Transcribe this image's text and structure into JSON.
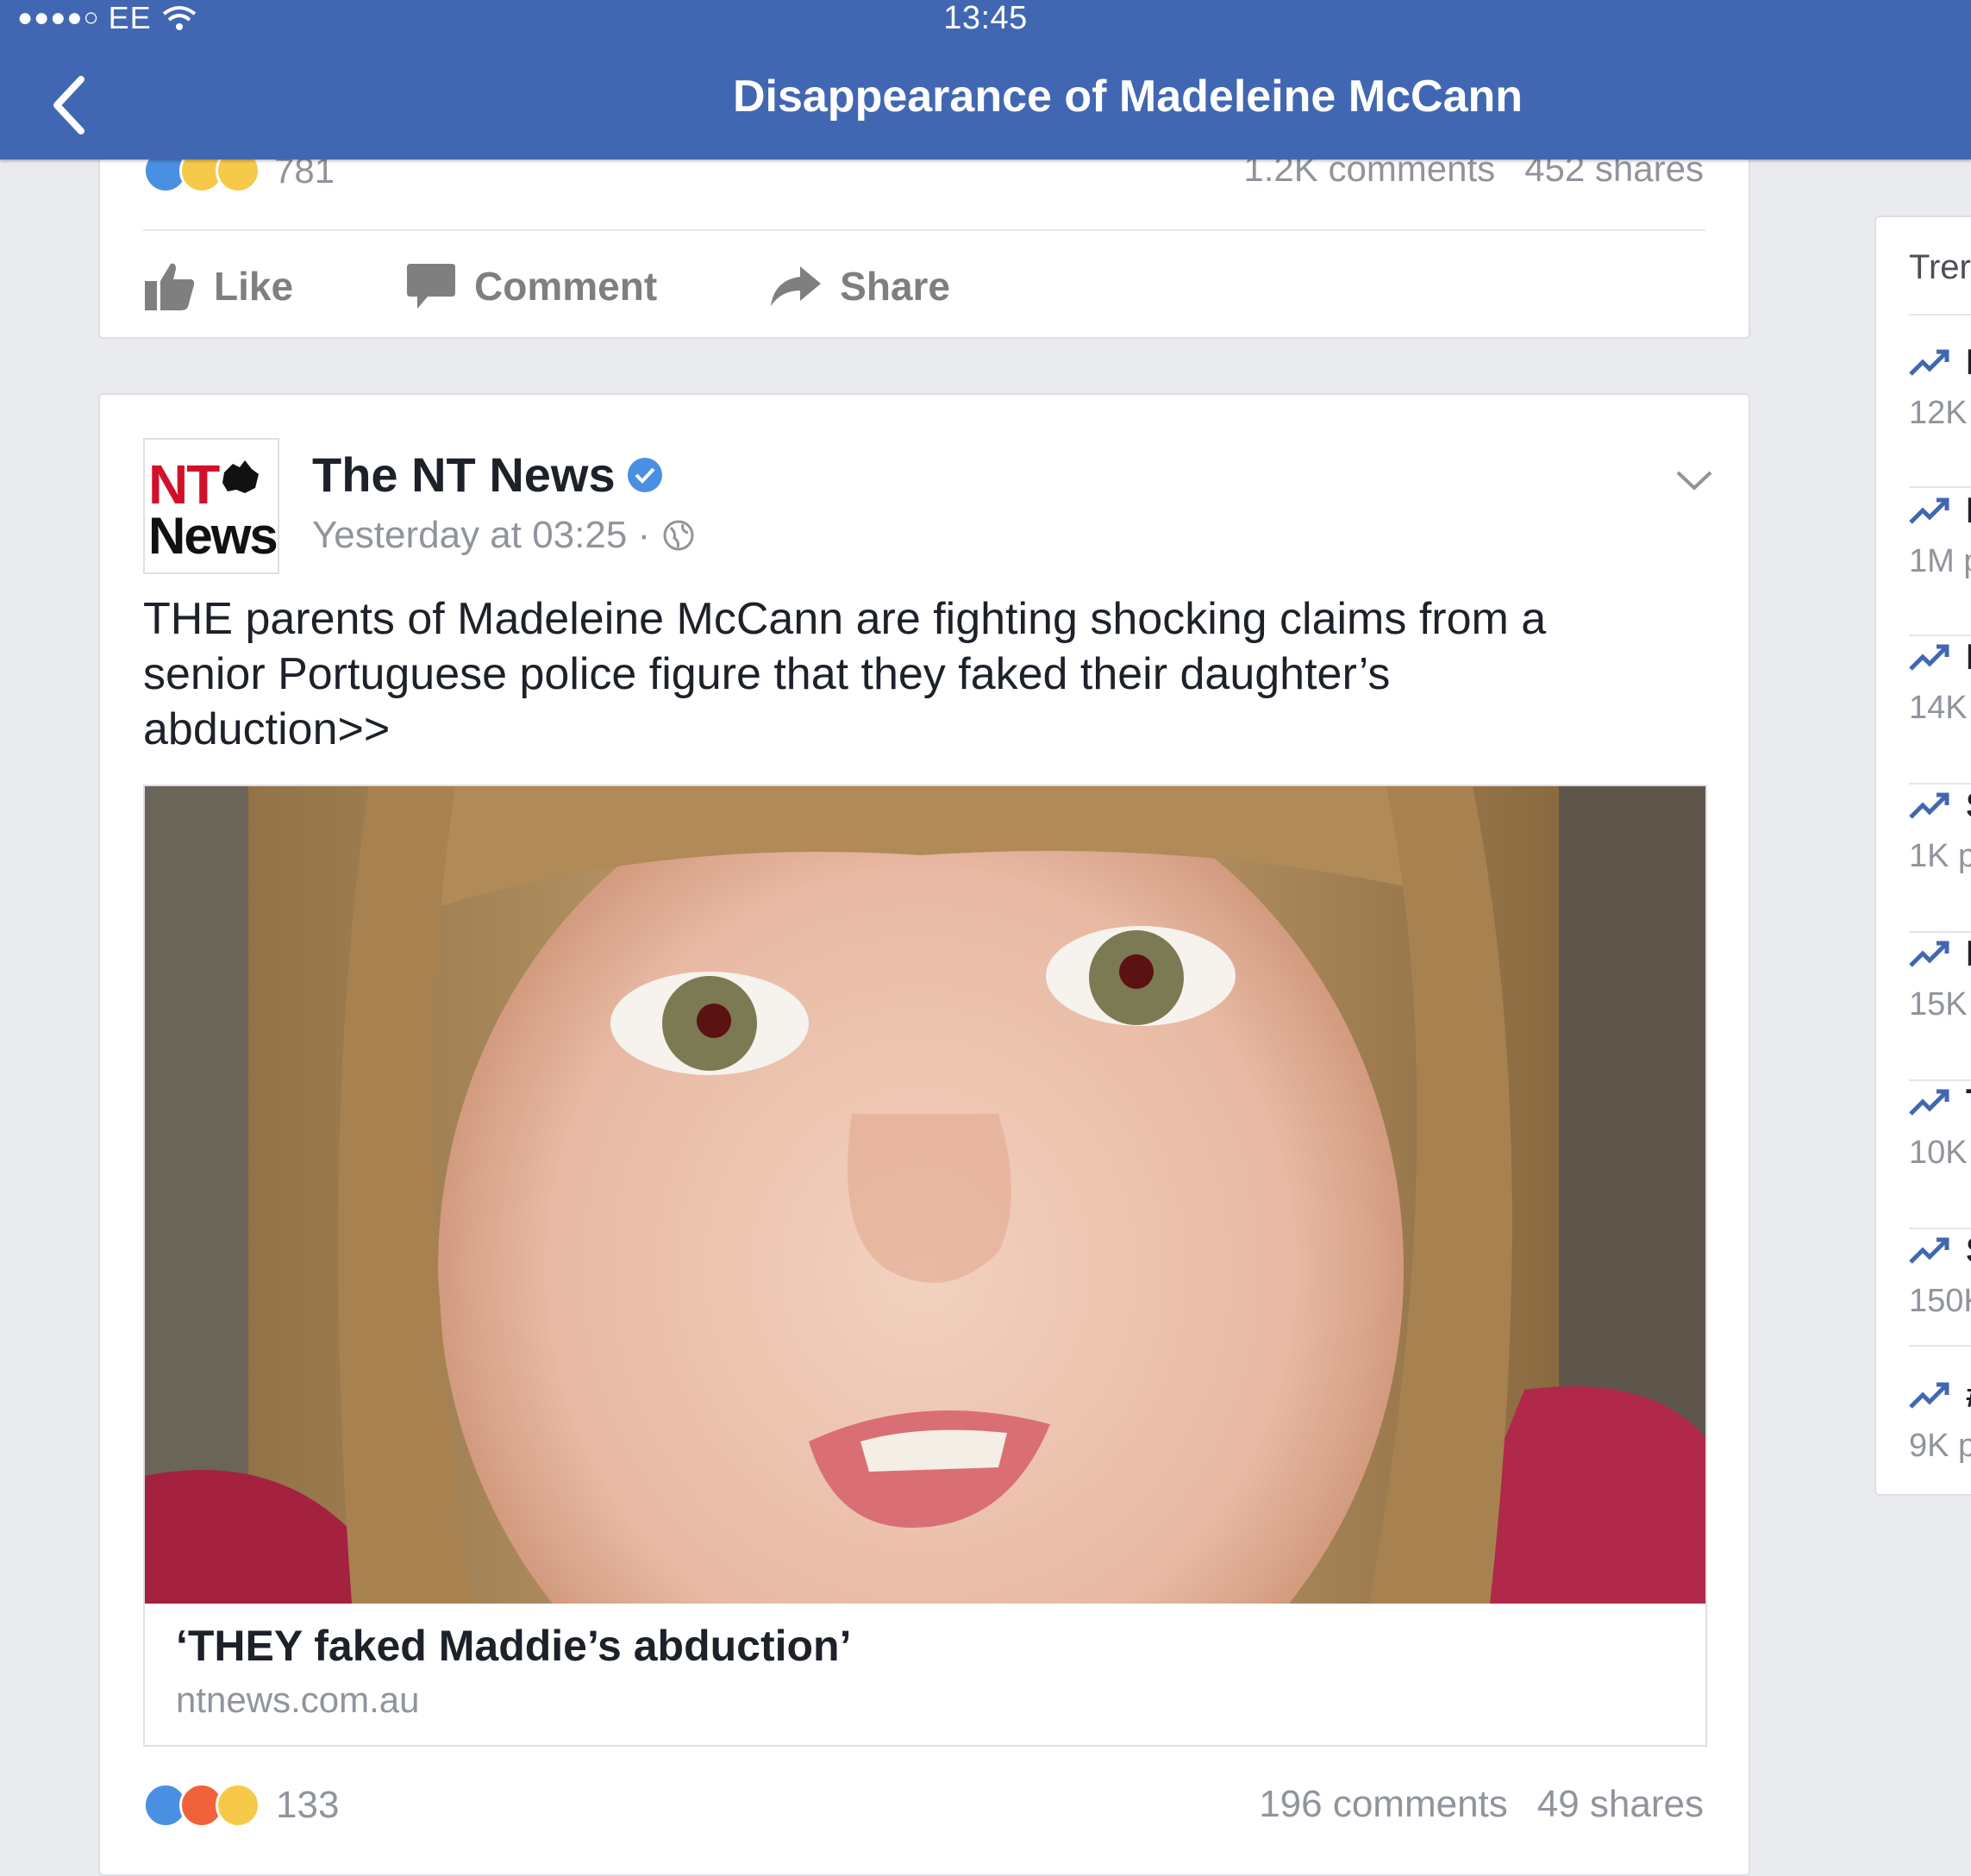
{
  "status_bar": {
    "signal": "●●●●○",
    "carrier": "EE",
    "time": "13:45"
  },
  "header": {
    "title": "Disappearance of Madeleine McCann"
  },
  "prev_post": {
    "reaction_count": "781",
    "comments": "1.2K comments",
    "shares": "452 shares",
    "actions": {
      "like": "Like",
      "comment": "Comment",
      "share": "Share"
    }
  },
  "post": {
    "page_name": "The NT News",
    "logo_line1": "NT",
    "logo_line2": "News",
    "timestamp": "Yesterday at 03:25 ·",
    "text": "THE parents of Madeleine McCann are fighting shocking claims from a senior Portuguese police figure that they faked their daughter’s abduction>>",
    "link_title": "‘THEY faked Maddie’s abduction’",
    "link_domain": "ntnews.com.au",
    "reaction_count": "133",
    "comments": "196 comments",
    "shares": "49 shares"
  },
  "trending": {
    "heading": "Trer",
    "items": [
      {
        "name": "I",
        "count": "12K"
      },
      {
        "name": "I",
        "count": "1M p"
      },
      {
        "name": "I",
        "count": "14K"
      },
      {
        "name": "S",
        "count": "1K p"
      },
      {
        "name": "I",
        "count": "15K"
      },
      {
        "name": "T",
        "count": "10K"
      },
      {
        "name": "S",
        "count": "150K"
      },
      {
        "name": "#",
        "count": "9K p"
      }
    ]
  },
  "colors": {
    "brand": "#4267b2",
    "verified": "#4a90e2",
    "muted": "#90949c"
  }
}
